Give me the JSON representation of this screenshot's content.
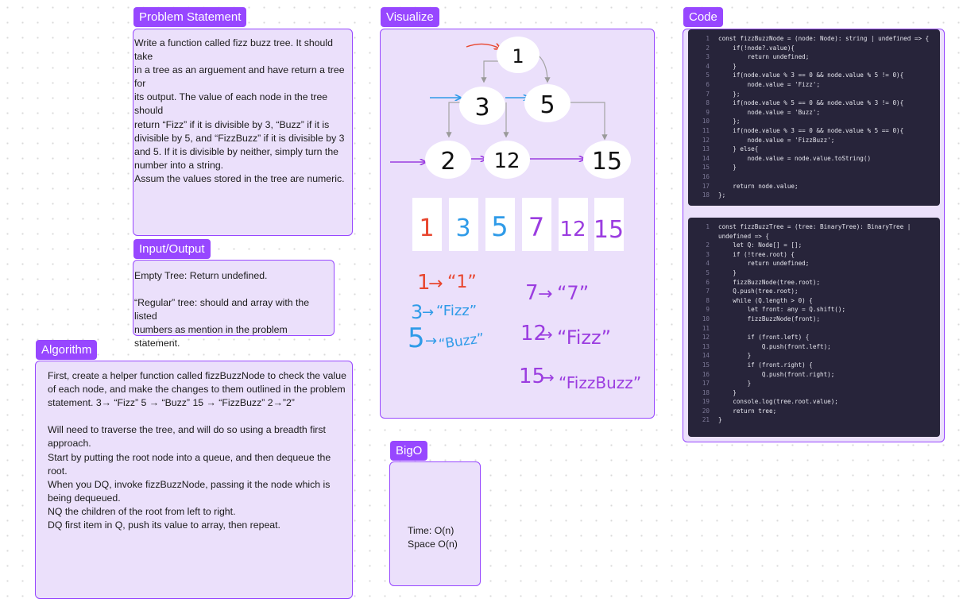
{
  "problem": {
    "tag": "Problem Statement",
    "lines": [
      "Write a function called fizz buzz tree. It should take",
      "in a tree as an arguement and have return a tree for",
      "its output. The value of each node in the tree should",
      "return “Fizz” if it is divisible by 3, “Buzz” if it is",
      "divisible by 5, and “FizzBuzz” if it is divisible by 3",
      "and 5. If it is divisible by neither, simply turn the",
      "number into a string.",
      "Assum the values stored in the tree are numeric."
    ]
  },
  "io": {
    "tag": "Input/Output",
    "lines": [
      "Empty Tree: Return undefined.",
      "",
      "“Regular” tree: should and array with the listed",
      "numbers as mention in the problem statement."
    ]
  },
  "algorithm": {
    "tag": "Algorithm",
    "lines": [
      "First, create a helper function called fizzBuzzNode to check the value",
      "of each node, and make the changes to them outlined in the problem",
      "statement. 3→ “Fizz” 5 → “Buzz” 15 → “FizzBuzz” 2→”2”",
      "",
      "Will need to traverse the tree, and will do so using a breadth first",
      "approach.",
      "Start by putting the root node into a queue, and then dequeue the",
      "root.",
      "When you DQ, invoke fizzBuzzNode, passing it the node which is",
      "being dequeued.",
      "NQ the children of the root from left to right.",
      "DQ first item in Q, push its value to array, then repeat."
    ]
  },
  "visualize": {
    "tag": "Visualize",
    "tree_nodes": [
      "1",
      "3",
      "5",
      "2",
      "12",
      "15"
    ],
    "array_cells": [
      "1",
      "3",
      "5",
      "7",
      "12",
      "15"
    ],
    "mappings": [
      {
        "from": "1",
        "to": "“1”"
      },
      {
        "from": "7",
        "to": "“7”"
      },
      {
        "from": "3",
        "to": "“Fizz”"
      },
      {
        "from": "5",
        "to": "“Buzz”"
      },
      {
        "from": "12",
        "to": "“Fizz”"
      },
      {
        "from": "15",
        "to": "“FizzBuzz”"
      }
    ]
  },
  "bigo": {
    "tag": "BigO",
    "time": "Time: O(n)",
    "space": "Space O(n)"
  },
  "code": {
    "tag": "Code",
    "block1": [
      "const fizzBuzzNode = (node: Node): string | undefined => {",
      "    if(!node?.value){",
      "        return undefined;",
      "    }",
      "    if(node.value % 3 == 0 && node.value % 5 != 0){",
      "        node.value = 'Fizz';",
      "    };",
      "    if(node.value % 5 == 0 && node.value % 3 != 0){",
      "        node.value = 'Buzz';",
      "    };",
      "    if(node.value % 3 == 0 && node.value % 5 == 0){",
      "        node.value = 'FizzBuzz';",
      "    } else{",
      "        node.value = node.value.toString()",
      "    }",
      "",
      "    return node.value;",
      "};"
    ],
    "block2": [
      {
        "n": "1",
        "t": "const fizzBuzzTree = (tree: BinaryTree): BinaryTree |"
      },
      {
        "n": "",
        "t": "undefined => {"
      },
      {
        "n": "2",
        "t": "    let Q: Node[] = [];"
      },
      {
        "n": "3",
        "t": "    if (!tree.root) {"
      },
      {
        "n": "4",
        "t": "        return undefined;"
      },
      {
        "n": "5",
        "t": "    }"
      },
      {
        "n": "6",
        "t": "    fizzBuzzNode(tree.root);"
      },
      {
        "n": "7",
        "t": "    Q.push(tree.root);"
      },
      {
        "n": "8",
        "t": "    while (Q.length > 0) {"
      },
      {
        "n": "9",
        "t": "        let front: any = Q.shift();"
      },
      {
        "n": "10",
        "t": "        fizzBuzzNode(front);"
      },
      {
        "n": "11",
        "t": ""
      },
      {
        "n": "12",
        "t": "        if (front.left) {"
      },
      {
        "n": "13",
        "t": "            Q.push(front.left);"
      },
      {
        "n": "14",
        "t": "        }"
      },
      {
        "n": "15",
        "t": "        if (front.right) {"
      },
      {
        "n": "16",
        "t": "            Q.push(front.right);"
      },
      {
        "n": "17",
        "t": "        }"
      },
      {
        "n": "18",
        "t": "    }"
      },
      {
        "n": "19",
        "t": "    console.log(tree.root.value);"
      },
      {
        "n": "20",
        "t": "    return tree;"
      },
      {
        "n": "21",
        "t": "}"
      }
    ]
  },
  "colors": {
    "accent": "#9747ff",
    "frame_fill": "#ebe0fb",
    "code_bg": "#27243a",
    "ink_red": "#e8462e",
    "ink_blue": "#2f9be8",
    "ink_purple": "#9b3de0"
  }
}
